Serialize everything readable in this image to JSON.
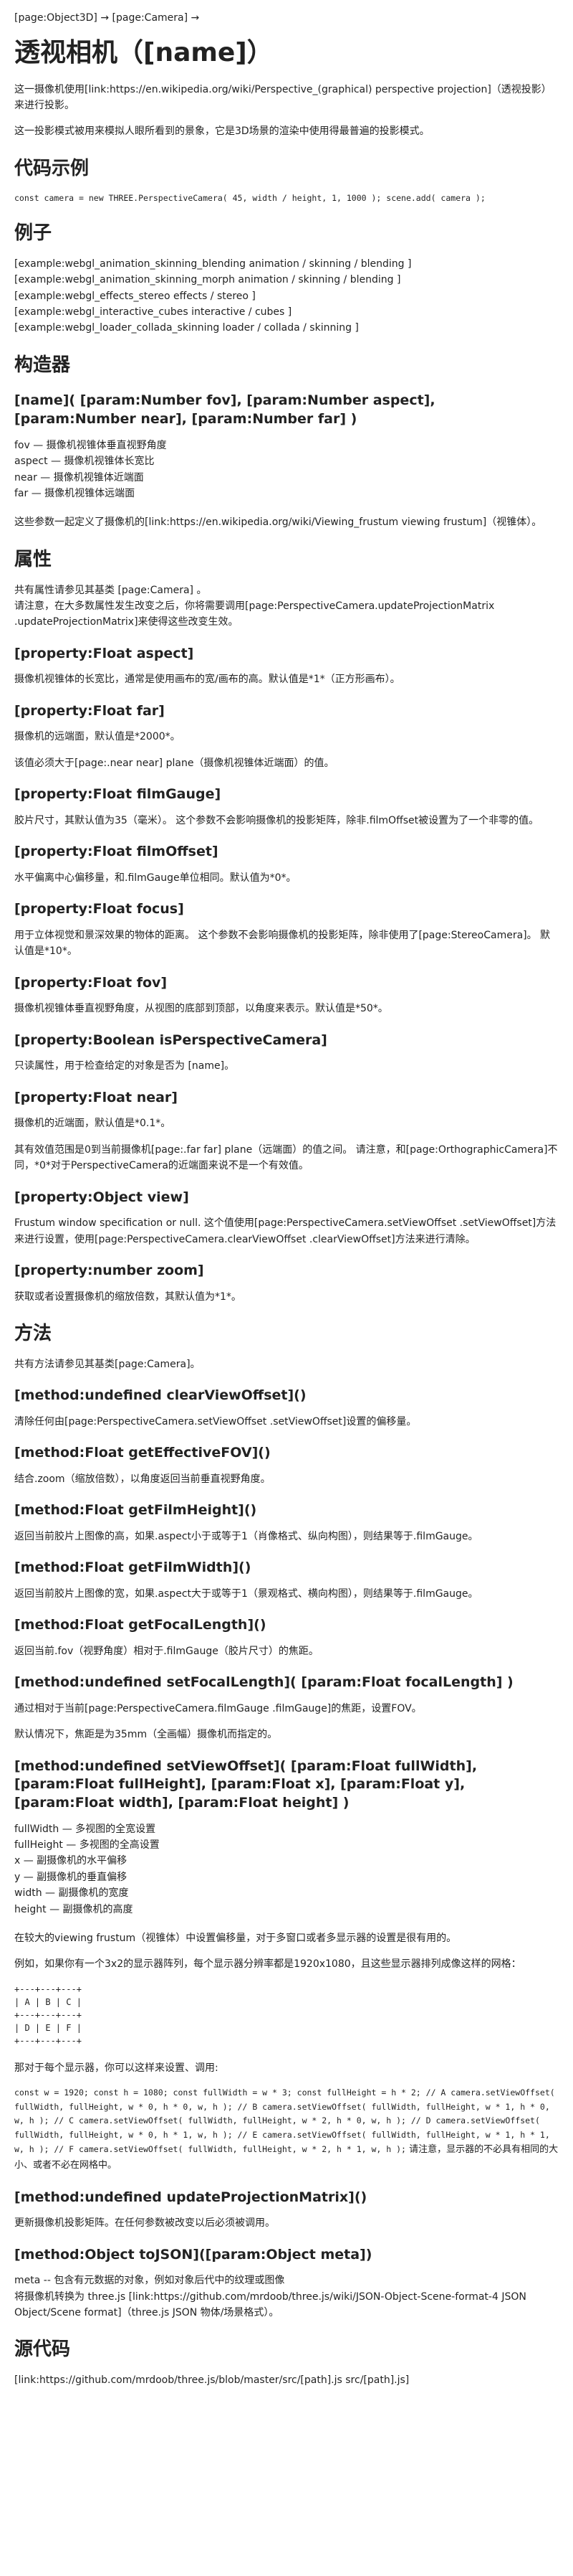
{
  "breadcrumb": "[page:Object3D] → [page:Camera] →",
  "title": "透视相机（[name]）",
  "intro": [
    "这一摄像机使用[link:https://en.wikipedia.org/wiki/Perspective_(graphical) perspective projection]（透视投影）来进行投影。",
    "这一投影模式被用来模拟人眼所看到的景象，它是3D场景的渲染中使用得最普遍的投影模式。"
  ],
  "code_example": {
    "heading": "代码示例",
    "code": "const camera = new THREE.PerspectiveCamera( 45, width / height, 1, 1000 ); scene.add( camera );"
  },
  "examples": {
    "heading": "例子",
    "items": [
      "[example:webgl_animation_skinning_blending animation / skinning / blending ]",
      "[example:webgl_animation_skinning_morph animation / skinning / blending ]",
      "[example:webgl_effects_stereo effects / stereo ]",
      "[example:webgl_interactive_cubes interactive / cubes ]",
      "[example:webgl_loader_collada_skinning loader / collada / skinning ]"
    ]
  },
  "constructor": {
    "heading": "构造器",
    "signature": "[name]( [param:Number fov], [param:Number aspect], [param:Number near], [param:Number far] )",
    "params": [
      "fov — 摄像机视锥体垂直视野角度",
      "aspect — 摄像机视锥体长宽比",
      "near — 摄像机视锥体近端面",
      "far — 摄像机视锥体远端面"
    ],
    "note": "这些参数一起定义了摄像机的[link:https://en.wikipedia.org/wiki/Viewing_frustum viewing frustum]（视锥体）。"
  },
  "properties": {
    "heading": "属性",
    "intro": "共有属性请参见其基类 [page:Camera] 。\n请注意，在大多数属性发生改变之后，你将需要调用[page:PerspectiveCamera.updateProjectionMatrix .updateProjectionMatrix]来使得这些改变生效。",
    "items": [
      {
        "sig": "[property:Float aspect]",
        "desc": [
          "摄像机视锥体的长宽比，通常是使用画布的宽/画布的高。默认值是*1*（正方形画布）。"
        ]
      },
      {
        "sig": "[property:Float far]",
        "desc": [
          "摄像机的远端面，默认值是*2000*。",
          "该值必须大于[page:.near near] plane（摄像机视锥体近端面）的值。"
        ]
      },
      {
        "sig": "[property:Float filmGauge]",
        "desc": [
          "胶片尺寸，其默认值为35（毫米）。 这个参数不会影响摄像机的投影矩阵，除非.filmOffset被设置为了一个非零的值。"
        ]
      },
      {
        "sig": "[property:Float filmOffset]",
        "desc": [
          "水平偏离中心偏移量，和.filmGauge单位相同。默认值为*0*。"
        ]
      },
      {
        "sig": "[property:Float focus]",
        "desc": [
          "用于立体视觉和景深效果的物体的距离。 这个参数不会影响摄像机的投影矩阵，除非使用了[page:StereoCamera]。 默认值是*10*。"
        ]
      },
      {
        "sig": "[property:Float fov]",
        "desc": [
          "摄像机视锥体垂直视野角度，从视图的底部到顶部，以角度来表示。默认值是*50*。"
        ]
      },
      {
        "sig": "[property:Boolean isPerspectiveCamera]",
        "desc": [
          "只读属性，用于检查给定的对象是否为 [name]。"
        ]
      },
      {
        "sig": "[property:Float near]",
        "desc": [
          "摄像机的近端面，默认值是*0.1*。",
          "其有效值范围是0到当前摄像机[page:.far far] plane（远端面）的值之间。 请注意，和[page:OrthographicCamera]不同，*0*对于PerspectiveCamera的近端面来说不是一个有效值。"
        ]
      },
      {
        "sig": "[property:Object view]",
        "desc": [
          "Frustum window specification or null. 这个值使用[page:PerspectiveCamera.setViewOffset .setViewOffset]方法来进行设置，使用[page:PerspectiveCamera.clearViewOffset .clearViewOffset]方法来进行清除。"
        ]
      },
      {
        "sig": "[property:number zoom]",
        "desc": [
          "获取或者设置摄像机的缩放倍数，其默认值为*1*。"
        ]
      }
    ]
  },
  "methods": {
    "heading": "方法",
    "intro": "共有方法请参见其基类[page:Camera]。",
    "items": [
      {
        "sig": "[method:undefined clearViewOffset]()",
        "desc": [
          "清除任何由[page:PerspectiveCamera.setViewOffset .setViewOffset]设置的偏移量。"
        ]
      },
      {
        "sig": "[method:Float getEffectiveFOV]()",
        "desc": [
          "结合.zoom（缩放倍数），以角度返回当前垂直视野角度。"
        ]
      },
      {
        "sig": "[method:Float getFilmHeight]()",
        "desc": [
          "返回当前胶片上图像的高，如果.aspect小于或等于1（肖像格式、纵向构图），则结果等于.filmGauge。"
        ]
      },
      {
        "sig": "[method:Float getFilmWidth]()",
        "desc": [
          "返回当前胶片上图像的宽，如果.aspect大于或等于1（景观格式、横向构图），则结果等于.filmGauge。"
        ]
      },
      {
        "sig": "[method:Float getFocalLength]()",
        "desc": [
          "返回当前.fov（视野角度）相对于.filmGauge（胶片尺寸）的焦距。"
        ]
      },
      {
        "sig": "[method:undefined setFocalLength]( [param:Float focalLength] )",
        "desc": [
          "通过相对于当前[page:PerspectiveCamera.filmGauge .filmGauge]的焦距，设置FOV。",
          "默认情况下，焦距是为35mm（全画幅）摄像机而指定的。"
        ]
      }
    ],
    "setViewOffset": {
      "sig": "[method:undefined setViewOffset]( [param:Float fullWidth], [param:Float fullHeight], [param:Float x], [param:Float y], [param:Float width], [param:Float height] )",
      "params": [
        "fullWidth — 多视图的全宽设置",
        "fullHeight — 多视图的全高设置",
        "x — 副摄像机的水平偏移",
        "y — 副摄像机的垂直偏移",
        "width — 副摄像机的宽度",
        "height — 副摄像机的高度"
      ],
      "desc1": "在较大的viewing frustum（视锥体）中设置偏移量，对于多窗口或者多显示器的设置是很有用的。",
      "desc2": "例如，如果你有一个3x2的显示器阵列，每个显示器分辨率都是1920x1080，且这些显示器排列成像这样的网格：",
      "grid": "+---+---+---+\n| A | B | C |\n+---+---+---+\n| D | E | F |\n+---+---+---+",
      "desc3": "那对于每个显示器，你可以这样来设置、调用:",
      "code_parts": [
        "const w = 1920; const h = 1080; const fullWidth = w * 3; const fullHeight = h * 2; // A camera.setViewOffset( fullWidth, fullHeight, w * 0, h * 0, w, h ); // B camera.setViewOffset( fullWidth, fullHeight, w * 1, h * 0, w, h ); // C camera.setViewOffset( fullWidth, fullHeight, w * 2, h * 0, w, h ); // D camera.setViewOffset( fullWidth, fullHeight, w * 0, h * 1, w, h ); // E camera.setViewOffset( fullWidth, fullHeight, w * 1, h * 1, w, h ); // F camera.setViewOffset( fullWidth, fullHeight, w * 2, h * 1, w, h );",
        " 请注意，显示器的不必具有相同的大小、或者不必在网格中。"
      ]
    },
    "tail": [
      {
        "sig": "[method:undefined updateProjectionMatrix]()",
        "desc": [
          "更新摄像机投影矩阵。在任何参数被改变以后必须被调用。"
        ]
      },
      {
        "sig": "[method:Object toJSON]([param:Object meta])",
        "desc": [
          "meta -- 包含有元数据的对象，例如对象后代中的纹理或图像\n将摄像机转换为 three.js [link:https://github.com/mrdoob/three.js/wiki/JSON-Object-Scene-format-4 JSON Object/Scene format]（three.js JSON 物体/场景格式）。"
        ]
      }
    ]
  },
  "source": {
    "heading": "源代码",
    "link": "[link:https://github.com/mrdoob/three.js/blob/master/src/[path].js src/[path].js]"
  }
}
